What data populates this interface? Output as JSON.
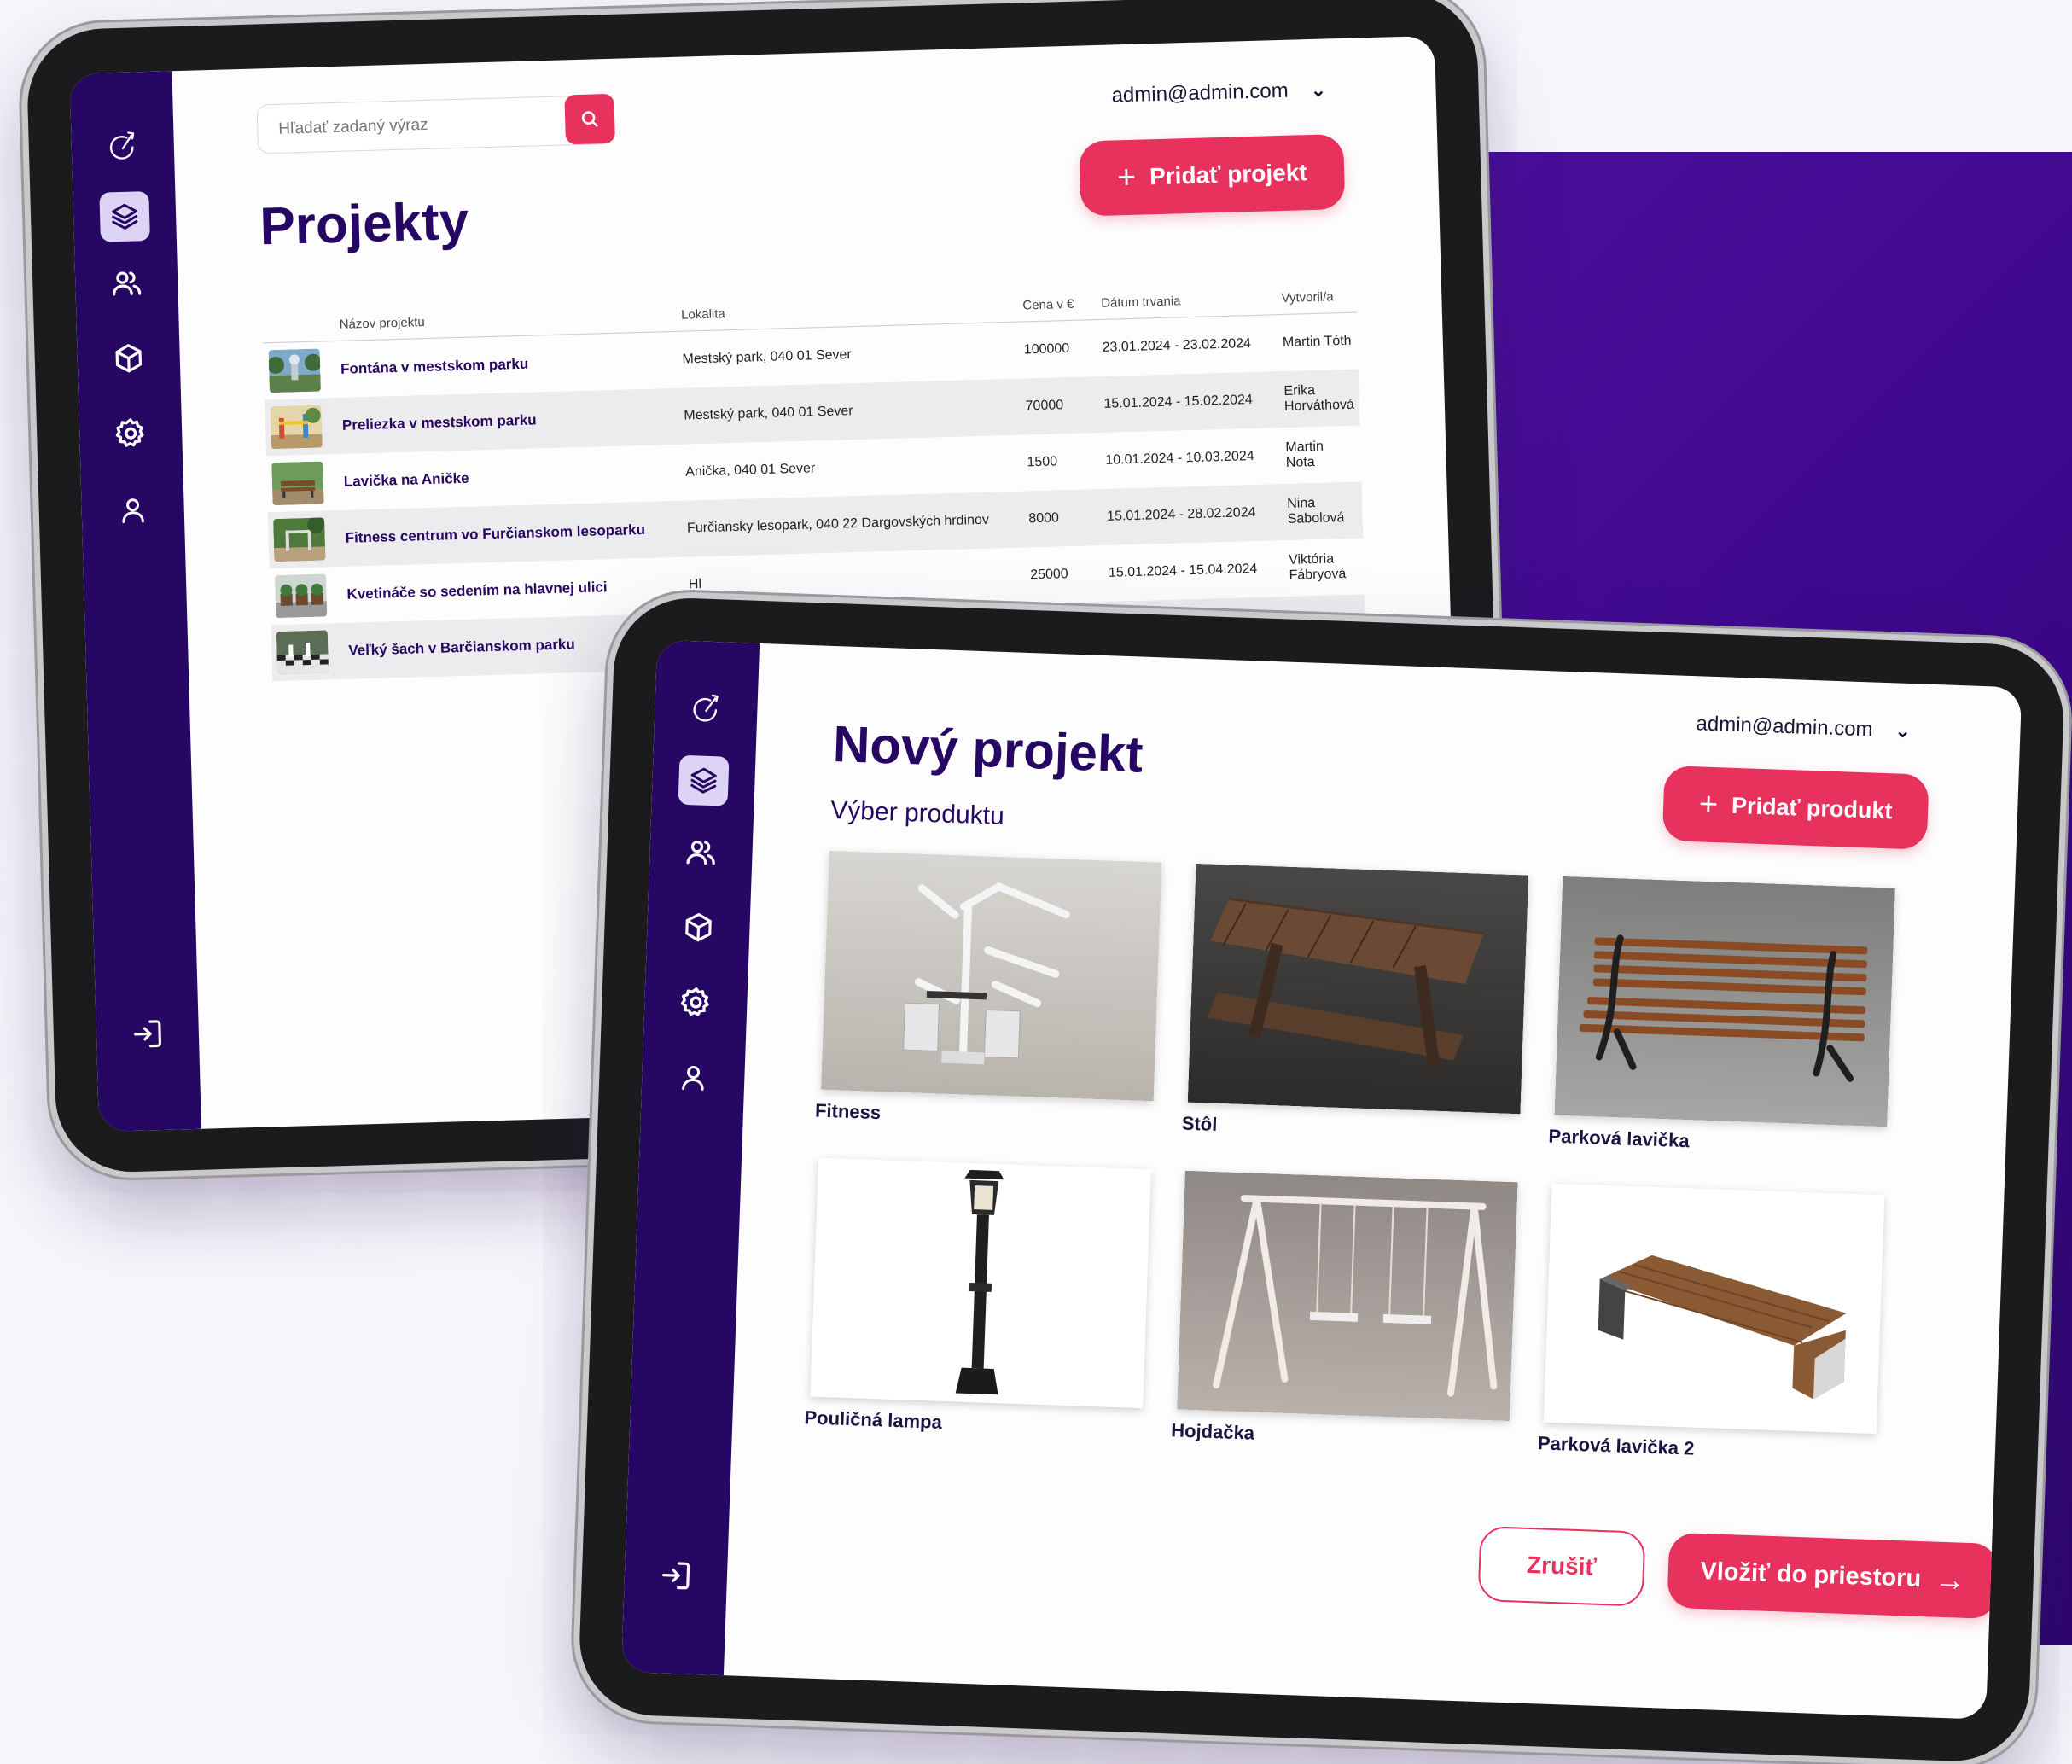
{
  "colors": {
    "brand_purple": "#260763",
    "accent_pink": "#e8325e",
    "background": "#f7f6fb"
  },
  "sidebar": {
    "icons": [
      "logo-icon",
      "layers-icon",
      "users-icon",
      "cube-icon",
      "gear-icon",
      "user-icon",
      "logout-icon"
    ],
    "active": "layers-icon"
  },
  "projects_screen": {
    "search": {
      "placeholder": "Hľadať zadaný výraz"
    },
    "user": {
      "email": "admin@admin.com",
      "caret": "⌄"
    },
    "title": "Projekty",
    "add_button": {
      "icon": "+",
      "label": "Pridať projekt"
    },
    "table": {
      "columns": [
        "Názov projektu",
        "Lokalita",
        "Cena v €",
        "Dátum trvania",
        "Vytvoril/a"
      ],
      "rows": [
        {
          "name": "Fontána v mestskom parku",
          "location": "Mestský park, 040 01 Sever",
          "price": "100000",
          "dates": "23.01.2024 - 23.02.2024",
          "author": "Martin Tóth"
        },
        {
          "name": "Preliezka v mestskom parku",
          "location": "Mestský park, 040 01 Sever",
          "price": "70000",
          "dates": "15.01.2024 - 15.02.2024",
          "author": "Erika Horváthová"
        },
        {
          "name": "Lavička na Aničke",
          "location": "Anička, 040 01 Sever",
          "price": "1500",
          "dates": "10.01.2024 - 10.03.2024",
          "author": "Martin Nota"
        },
        {
          "name": "Fitness centrum vo Furčianskom lesoparku",
          "location": "Furčiansky lesopark, 040 22 Dargovských hrdinov",
          "price": "8000",
          "dates": "15.01.2024 - 28.02.2024",
          "author": "Nina Sabolová"
        },
        {
          "name": "Kvetináče so sedením na hlavnej ulici",
          "location": "Hl",
          "price": "25000",
          "dates": "15.01.2024 - 15.04.2024",
          "author": "Viktória Fábryová"
        },
        {
          "name": "Veľký šach v Barčianskom parku",
          "location": "",
          "price": "",
          "dates": "",
          "author": ""
        }
      ]
    }
  },
  "new_project_screen": {
    "user": {
      "email": "admin@admin.com",
      "caret": "⌄"
    },
    "title": "Nový projekt",
    "subtitle": "Výber produktu",
    "add_button": {
      "icon": "+",
      "label": "Pridať produkt"
    },
    "products": [
      {
        "label": "Fitness",
        "image": "fitness-machine"
      },
      {
        "label": "Stôl",
        "image": "picnic-table"
      },
      {
        "label": "Parková lavička",
        "image": "park-bench"
      },
      {
        "label": "Pouličná lampa",
        "image": "street-lamp"
      },
      {
        "label": "Hojdačka",
        "image": "swing-set"
      },
      {
        "label": "Parková lavička 2",
        "image": "modern-bench"
      }
    ],
    "cancel_button": {
      "label": "Zrušiť"
    },
    "insert_button": {
      "label": "Vložiť do priestoru",
      "icon": "→"
    }
  }
}
